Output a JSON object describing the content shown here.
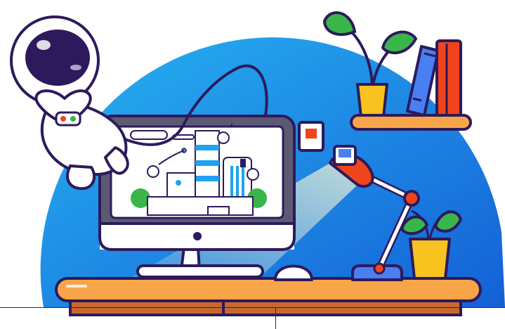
{
  "colors": {
    "outline": "#2d1a5c",
    "sky_top": "#1fa3ef",
    "sky_bottom": "#1565d8",
    "desk_top": "#f7a548",
    "desk_body": "#c9682e",
    "lamp": "#f0441d",
    "pot": "#f8c21f",
    "leaf": "#3ab54a",
    "book_blue": "#4a7ff2",
    "book_red": "#f0441d",
    "screen_bg": "#ffffff",
    "monitor_frame": "#5c5a73",
    "light_beam": "#fff6c2"
  },
  "icons": [
    "astronaut-illustration",
    "monitor-illustration",
    "desk-lamp-illustration",
    "potted-plant-illustration",
    "books-illustration",
    "computer-mouse-illustration",
    "sticky-note-icon"
  ]
}
